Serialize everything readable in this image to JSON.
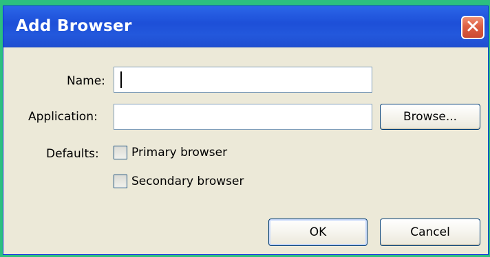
{
  "window": {
    "title": "Add Browser"
  },
  "form": {
    "name_label": "Name:",
    "name_value": "",
    "application_label": "Application:",
    "application_value": "",
    "browse_label": "Browse...",
    "defaults_label": "Defaults:",
    "primary_label": "Primary browser",
    "secondary_label": "Secondary browser",
    "primary_checked": false,
    "secondary_checked": false
  },
  "footer": {
    "ok_label": "OK",
    "cancel_label": "Cancel"
  },
  "icons": {
    "close": "close-icon"
  },
  "colors": {
    "title_bar": "#1d4fd8",
    "window_background": "#ece9d8",
    "close_button": "#dd5f43",
    "desktop": "#2cc07f"
  }
}
